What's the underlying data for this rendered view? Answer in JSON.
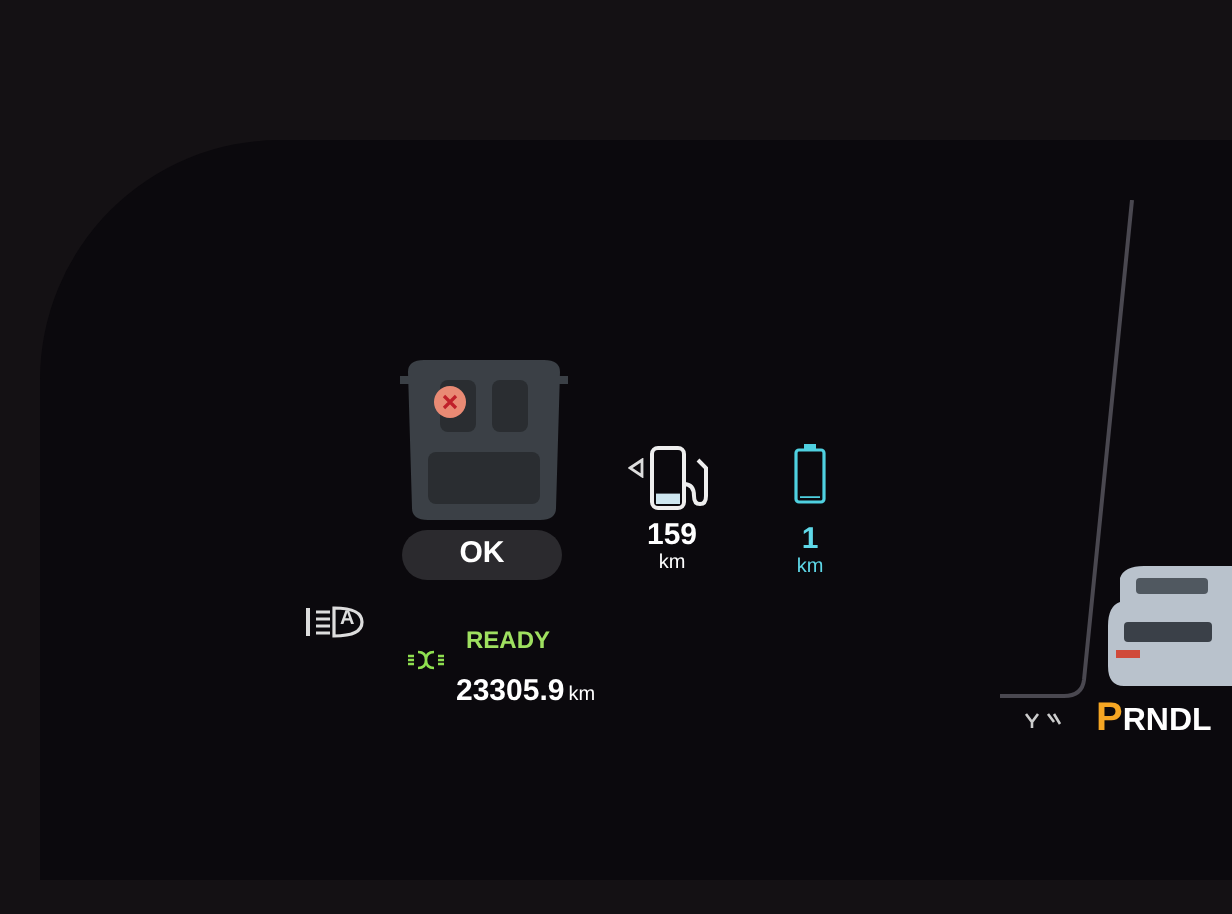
{
  "seat_status": {
    "warning": true,
    "label": "OK"
  },
  "fuel": {
    "level": 0.2,
    "range": "159",
    "unit": "km"
  },
  "battery": {
    "level": 0.04,
    "range": "1",
    "unit": "km"
  },
  "headlight_mode": "A",
  "status": "READY",
  "odometer": {
    "value": "23305.9",
    "unit": "km"
  },
  "gears": [
    {
      "label": "P",
      "selected": true
    },
    {
      "label": "R",
      "selected": false
    },
    {
      "label": "N",
      "selected": false
    },
    {
      "label": "D",
      "selected": false
    },
    {
      "label": "L",
      "selected": false
    }
  ]
}
